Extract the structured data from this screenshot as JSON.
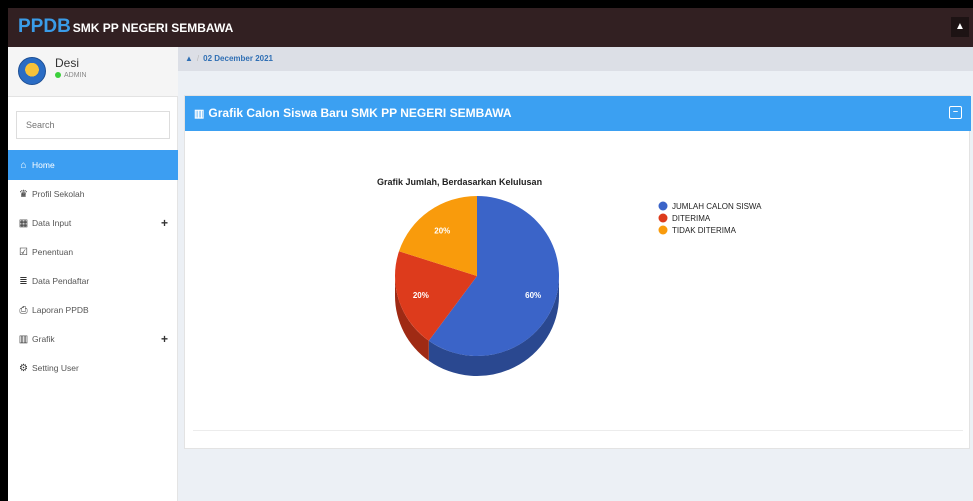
{
  "app": {
    "brand_big": "PPDB",
    "brand_small": "SMK PP NEGERI SEMBAWA"
  },
  "user": {
    "name": "Desi",
    "role": "ADMIN",
    "avatar_icon": "school-logo-icon"
  },
  "search": {
    "placeholder": "Search"
  },
  "sidebar": {
    "items": [
      {
        "label": "Home",
        "icon": "home-icon",
        "glyph": "⌂",
        "active": true
      },
      {
        "label": "Profil Sekolah",
        "icon": "graduation-cap-icon",
        "glyph": "♛"
      },
      {
        "label": "Data Input",
        "icon": "table-icon",
        "glyph": "▦",
        "expandable": true,
        "plus": "+"
      },
      {
        "label": "Penentuan",
        "icon": "checkbox-icon",
        "glyph": "☑"
      },
      {
        "label": "Data Pendaftar",
        "icon": "database-icon",
        "glyph": "≣"
      },
      {
        "label": "Laporan PPDB",
        "icon": "print-icon",
        "glyph": "⎙"
      },
      {
        "label": "Grafik",
        "icon": "bar-chart-icon",
        "glyph": "▥",
        "expandable": true,
        "plus": "+"
      },
      {
        "label": "Setting User",
        "icon": "gear-icon",
        "glyph": "⚙"
      }
    ]
  },
  "breadcrumb": {
    "date": "02 December 2021",
    "icon": "user-icon"
  },
  "panel": {
    "title": "Grafik Calon Siswa Baru SMK PP NEGERI SEMBAWA",
    "collapse_glyph": "–"
  },
  "chart_data": {
    "type": "pie",
    "title": "Grafik Jumlah, Berdasarkan Kelulusan",
    "series": [
      {
        "name": "JUMLAH CALON SISWA",
        "value": 60,
        "label": "60%",
        "color": "#3b64c8"
      },
      {
        "name": "DITERIMA",
        "value": 20,
        "label": "20%",
        "color": "#dd3b1c"
      },
      {
        "name": "TIDAK DITERIMA",
        "value": 20,
        "label": "20%",
        "color": "#f99b0c"
      }
    ],
    "legend_position": "right",
    "style": "3d"
  }
}
